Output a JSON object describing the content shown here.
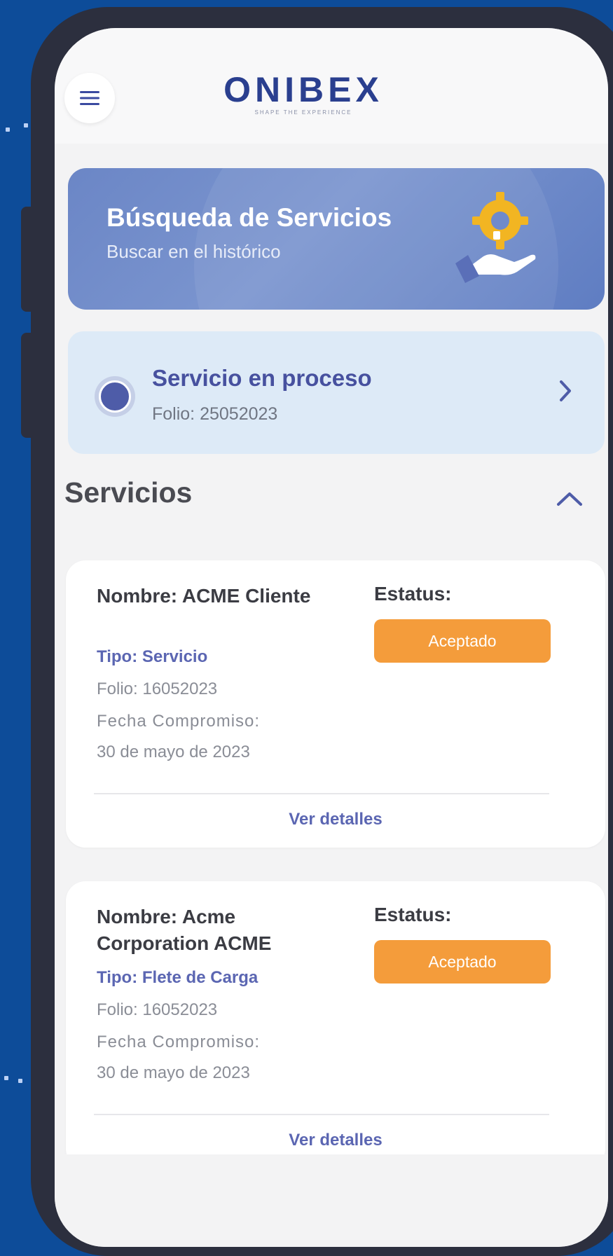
{
  "header": {
    "menu_icon": "hamburger-menu-icon",
    "logo_text": "ONIBEX",
    "logo_tagline": "SHAPE THE EXPERIENCE"
  },
  "search_card": {
    "title": "Búsqueda de Servicios",
    "subtitle": "Buscar en el histórico",
    "illustration": "hand-gear-icon"
  },
  "process_card": {
    "title": "Servicio en proceso",
    "folio": "Folio: 25052023",
    "chevron": "chevron-right-icon"
  },
  "services": {
    "title": "Servicios",
    "chevron": "chevron-up-icon",
    "items": [
      {
        "name": "Nombre: ACME Cliente",
        "type": "Tipo: Servicio",
        "folio": "Folio: 16052023",
        "fecha_label": "Fecha Compromiso:",
        "fecha": "30 de mayo de 2023",
        "status_label": "Estatus:",
        "status": "Aceptado",
        "details": "Ver detalles"
      },
      {
        "name": "Nombre: Acme Corporation ACME",
        "type": "Tipo: Flete de Carga",
        "folio": "Folio: 16052023",
        "fecha_label": "Fecha Compromiso:",
        "fecha": "30 de mayo de 2023",
        "status_label": "Estatus:",
        "status": "Aceptado",
        "details": "Ver detalles"
      }
    ]
  },
  "colors": {
    "background": "#0d4c99",
    "accent": "#47519f",
    "status": "#f49c3b"
  }
}
